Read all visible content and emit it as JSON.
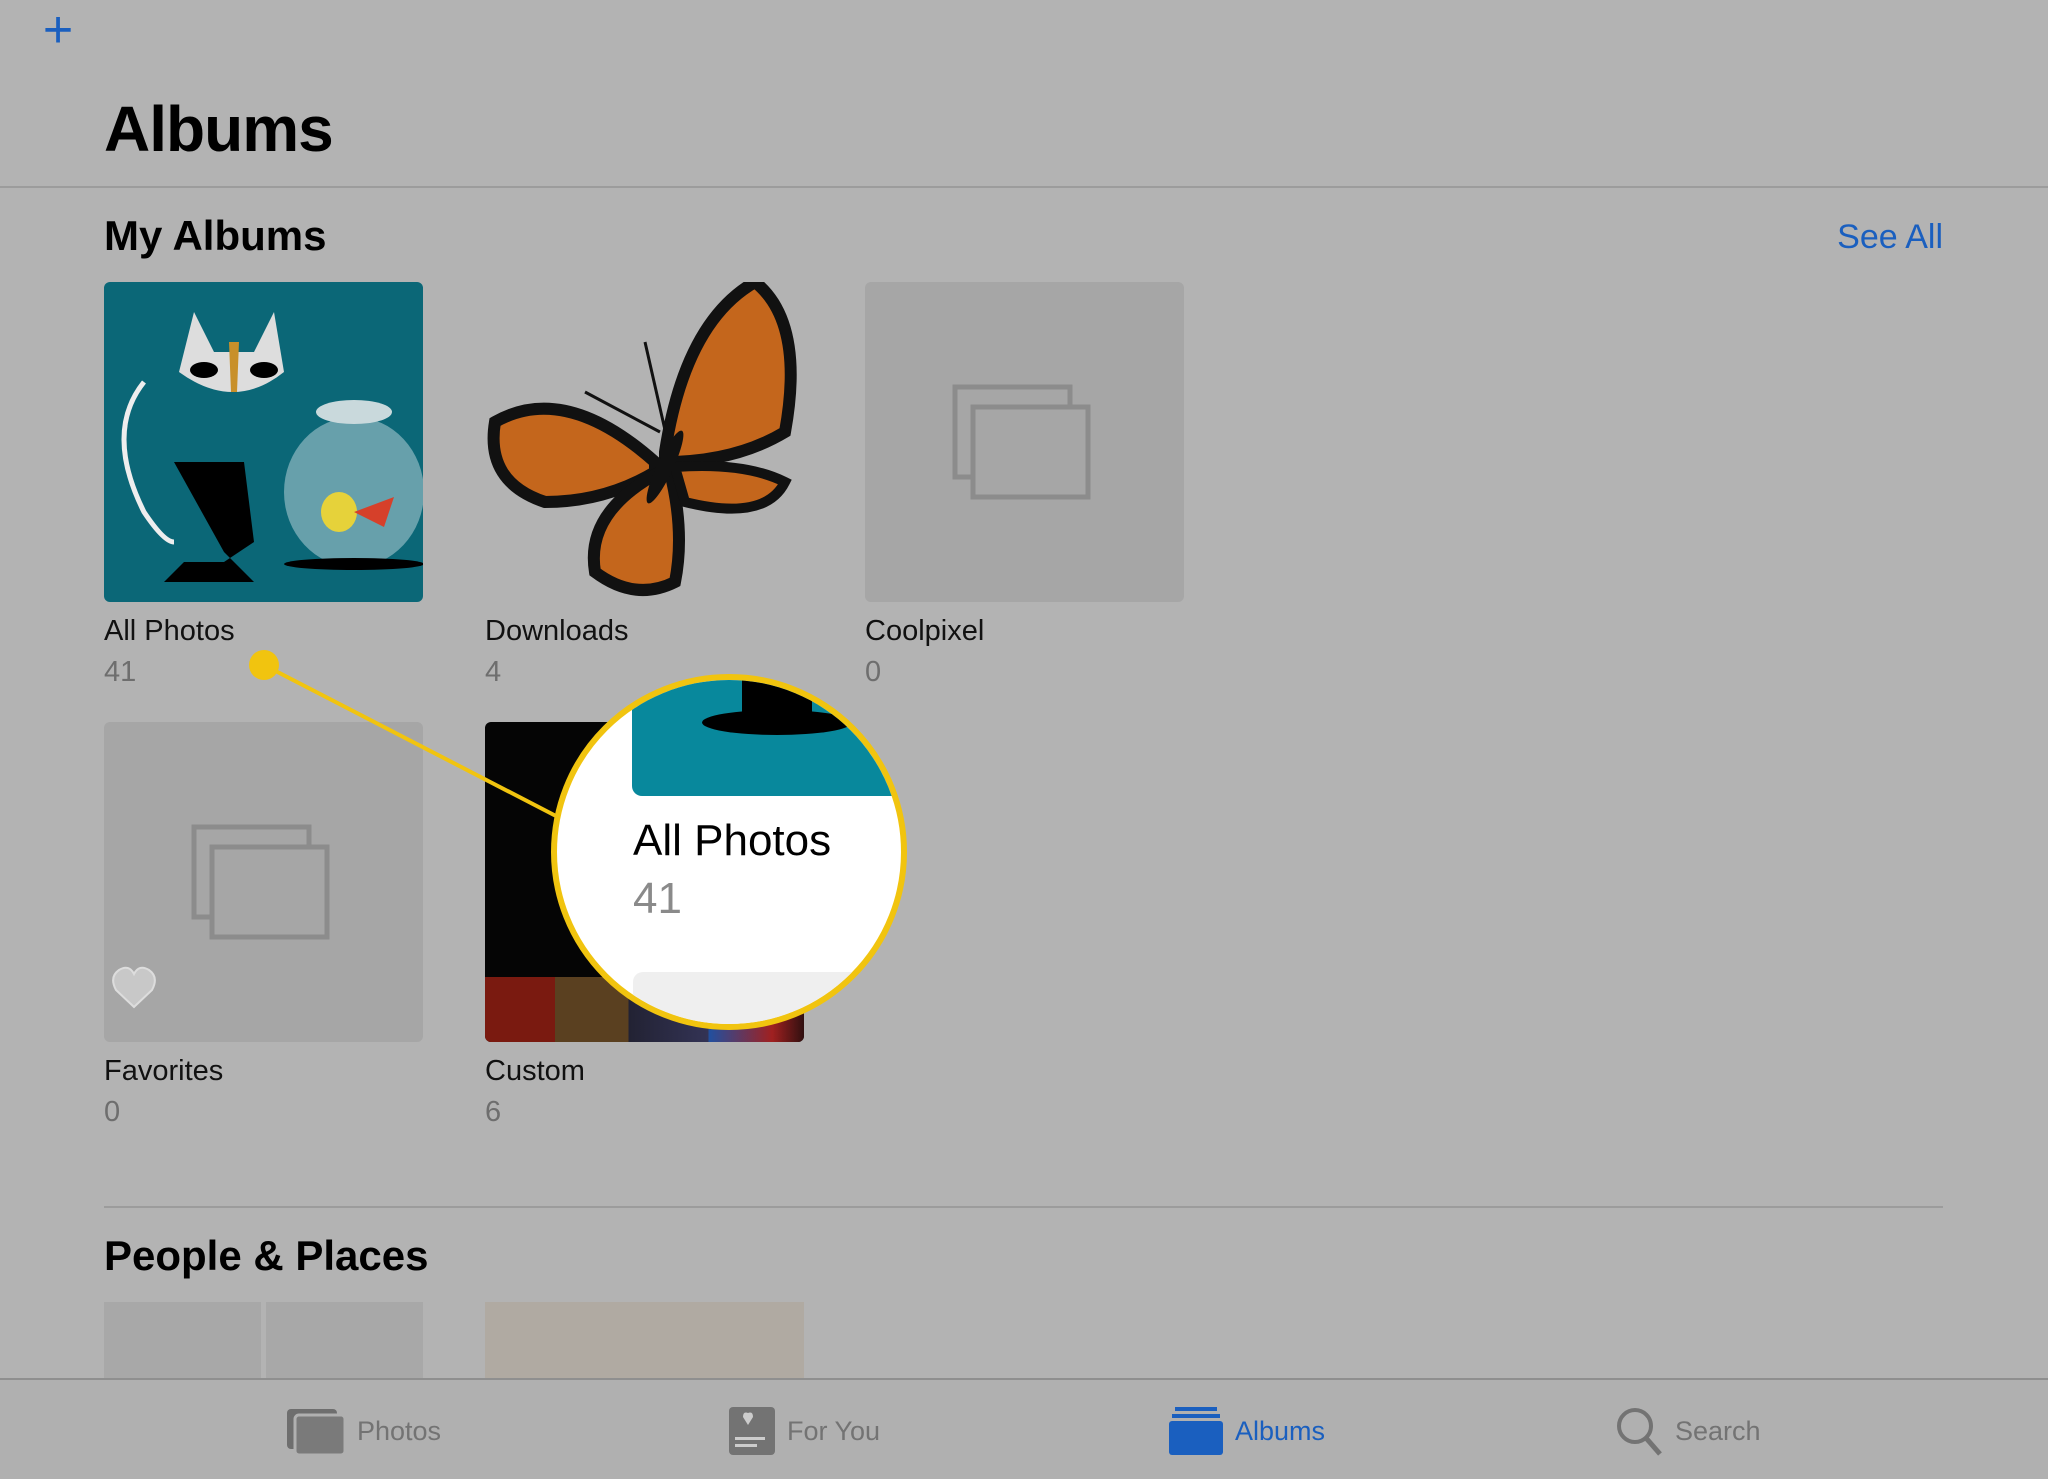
{
  "header": {
    "add_icon": "plus-icon",
    "title": "Albums"
  },
  "my_albums": {
    "title": "My Albums",
    "see_all": "See All",
    "albums": [
      {
        "name": "All Photos",
        "count": "41"
      },
      {
        "name": "Downloads",
        "count": "4"
      },
      {
        "name": "Coolpixel",
        "count": "0"
      },
      {
        "name": "Favorites",
        "count": "0"
      },
      {
        "name": "Custom",
        "count": "6"
      }
    ]
  },
  "people_places": {
    "title": "People & Places"
  },
  "magnifier": {
    "name": "All Photos",
    "count": "41"
  },
  "tabs": [
    {
      "label": "Photos",
      "icon": "photos-icon"
    },
    {
      "label": "For You",
      "icon": "for-you-icon"
    },
    {
      "label": "Albums",
      "icon": "albums-icon",
      "active": true
    },
    {
      "label": "Search",
      "icon": "search-icon"
    }
  ],
  "colors": {
    "accent": "#1a5fbf",
    "highlight": "#f1c40f",
    "background": "#b3b3b3"
  }
}
